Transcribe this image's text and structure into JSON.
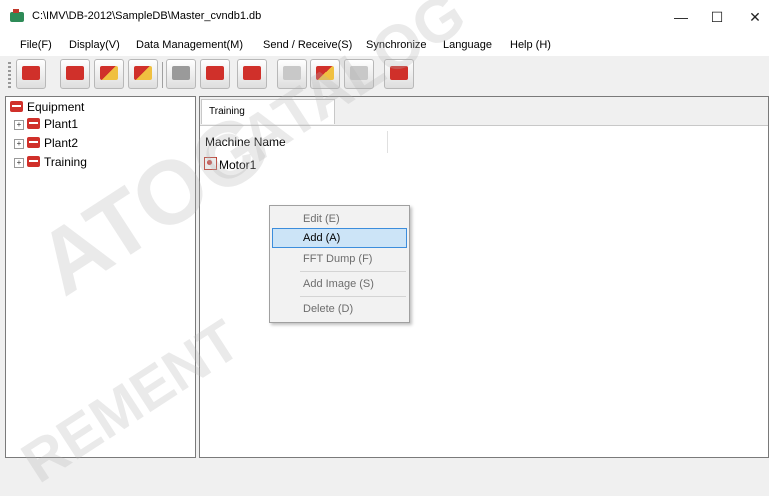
{
  "window": {
    "title": "C:\\IMV\\DB-2012\\SampleDB\\Master_cvndb1.db",
    "minimize": "—",
    "maximize": "☐",
    "close": "✕"
  },
  "menu": [
    "File(F)",
    "Display(V)",
    "Data Management(M)",
    "Send / Receive(S)",
    "Synchronize",
    "Language",
    "Help (H)"
  ],
  "toolbar_icons": [
    "open-db-icon",
    "machine-icon",
    "settings-icon",
    "measure-icon",
    "disabled-icon",
    "edit-icon",
    "list-icon",
    "sensor-icon",
    "send-icon",
    "receive-icon",
    "report-icon"
  ],
  "tree": {
    "root": "Equipment",
    "items": [
      "Plant1",
      "Plant2",
      "Training"
    ]
  },
  "tab": {
    "label": "Training"
  },
  "list": {
    "column_header": "Machine Name",
    "rows": [
      "Motor1"
    ]
  },
  "context_menu": {
    "items": [
      "Edit (E)",
      "Add (A)",
      "FFT Dump (F)",
      "Add Image (S)",
      "Delete (D)"
    ],
    "highlighted": "Add (A)"
  },
  "watermark": {
    "line1": "CATALOG",
    "line2": "ATOG",
    "line3": "REMENT"
  },
  "colors": {
    "accent_red": "#d0302a",
    "selection": "#cce4f7",
    "selection_border": "#3c8ddc"
  }
}
